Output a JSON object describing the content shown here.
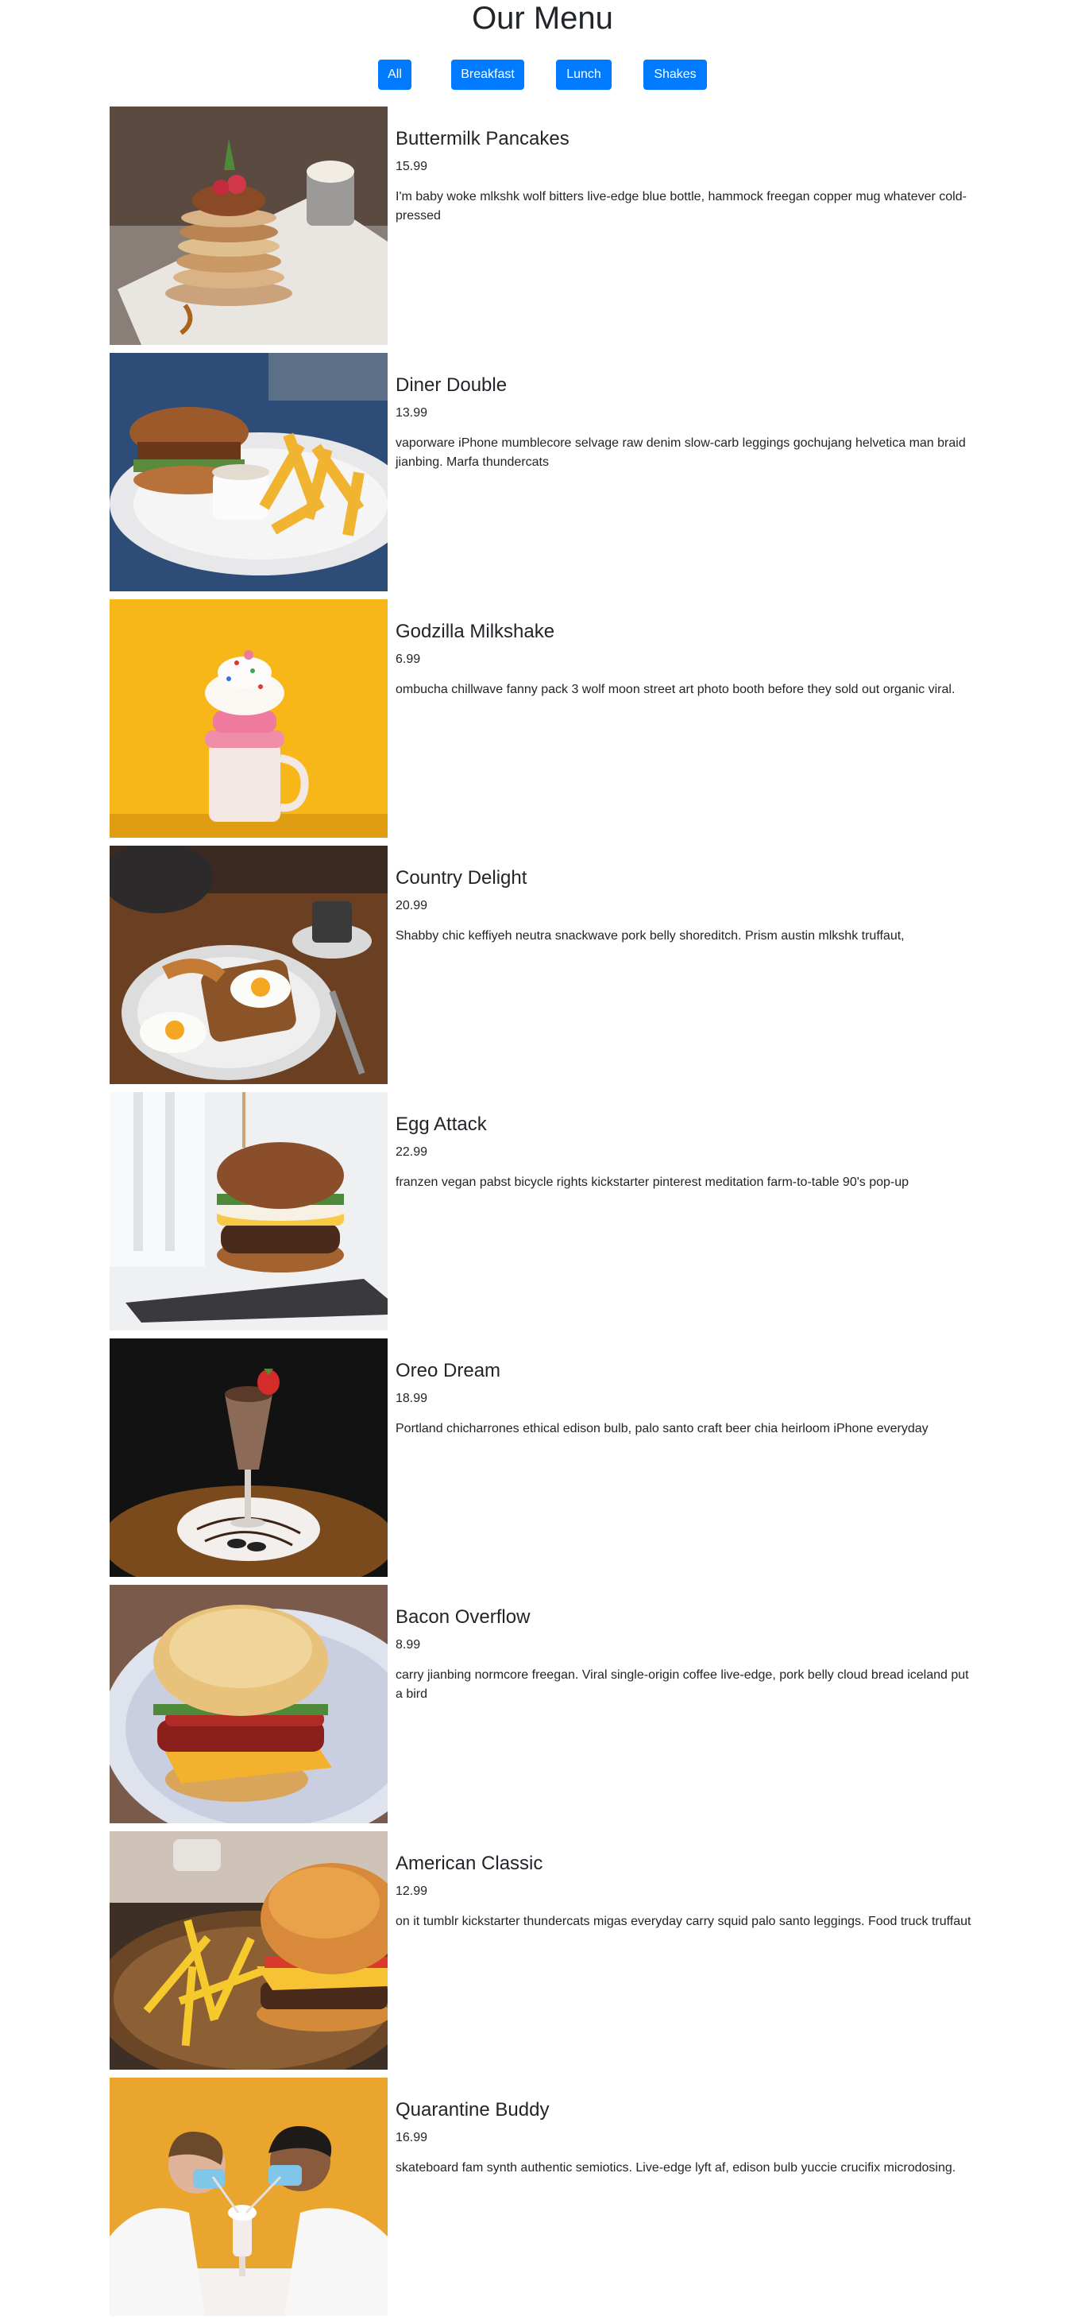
{
  "header": {
    "title": "Our Menu"
  },
  "filters": [
    {
      "label": "All"
    },
    {
      "label": "Breakfast"
    },
    {
      "label": "Lunch"
    },
    {
      "label": "Shakes"
    }
  ],
  "items": [
    {
      "title": "Buttermilk Pancakes",
      "price": "15.99",
      "desc": "I'm baby woke mlkshk wolf bitters live-edge blue bottle, hammock freegan copper mug whatever cold-pressed"
    },
    {
      "title": "Diner Double",
      "price": "13.99",
      "desc": "vaporware iPhone mumblecore selvage raw denim slow-carb leggings gochujang helvetica man braid jianbing. Marfa thundercats"
    },
    {
      "title": "Godzilla Milkshake",
      "price": "6.99",
      "desc": "ombucha chillwave fanny pack 3 wolf moon street art photo booth before they sold out organic viral."
    },
    {
      "title": "Country Delight",
      "price": "20.99",
      "desc": "Shabby chic keffiyeh neutra snackwave pork belly shoreditch. Prism austin mlkshk truffaut,"
    },
    {
      "title": "Egg Attack",
      "price": "22.99",
      "desc": "franzen vegan pabst bicycle rights kickstarter pinterest meditation farm-to-table 90's pop-up"
    },
    {
      "title": "Oreo Dream",
      "price": "18.99",
      "desc": "Portland chicharrones ethical edison bulb, palo santo craft beer chia heirloom iPhone everyday"
    },
    {
      "title": "Bacon Overflow",
      "price": "8.99",
      "desc": "carry jianbing normcore freegan. Viral single-origin coffee live-edge, pork belly cloud bread iceland put a bird"
    },
    {
      "title": "American Classic",
      "price": "12.99",
      "desc": "on it tumblr kickstarter thundercats migas everyday carry squid palo santo leggings. Food truck truffaut"
    },
    {
      "title": "Quarantine Buddy",
      "price": "16.99",
      "desc": "skateboard fam synth authentic semiotics. Live-edge lyft af, edison bulb yuccie crucifix microdosing."
    }
  ]
}
